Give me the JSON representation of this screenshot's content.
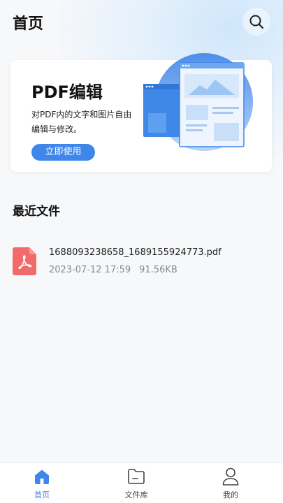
{
  "header": {
    "title": "首页",
    "search_icon": "search-icon"
  },
  "banner": {
    "title": "PDF编辑",
    "description": "对PDF内的文字和图片自由编辑与修改。",
    "button_label": "立即使用"
  },
  "recent": {
    "section_title": "最近文件",
    "files": [
      {
        "name": "1688093238658_1689155924773.pdf",
        "date": "2023-07-12 17:59",
        "size": "91.56KB",
        "icon": "pdf-file-icon"
      }
    ]
  },
  "tabbar": {
    "tabs": [
      {
        "label": "首页",
        "icon": "home-icon",
        "active": true
      },
      {
        "label": "文件库",
        "icon": "folder-icon",
        "active": false
      },
      {
        "label": "我的",
        "icon": "user-icon",
        "active": false
      }
    ]
  },
  "colors": {
    "accent": "#3e86ea",
    "pdf_red": "#f26b6b",
    "text_primary": "#111111",
    "text_secondary": "#8a8a8a"
  }
}
